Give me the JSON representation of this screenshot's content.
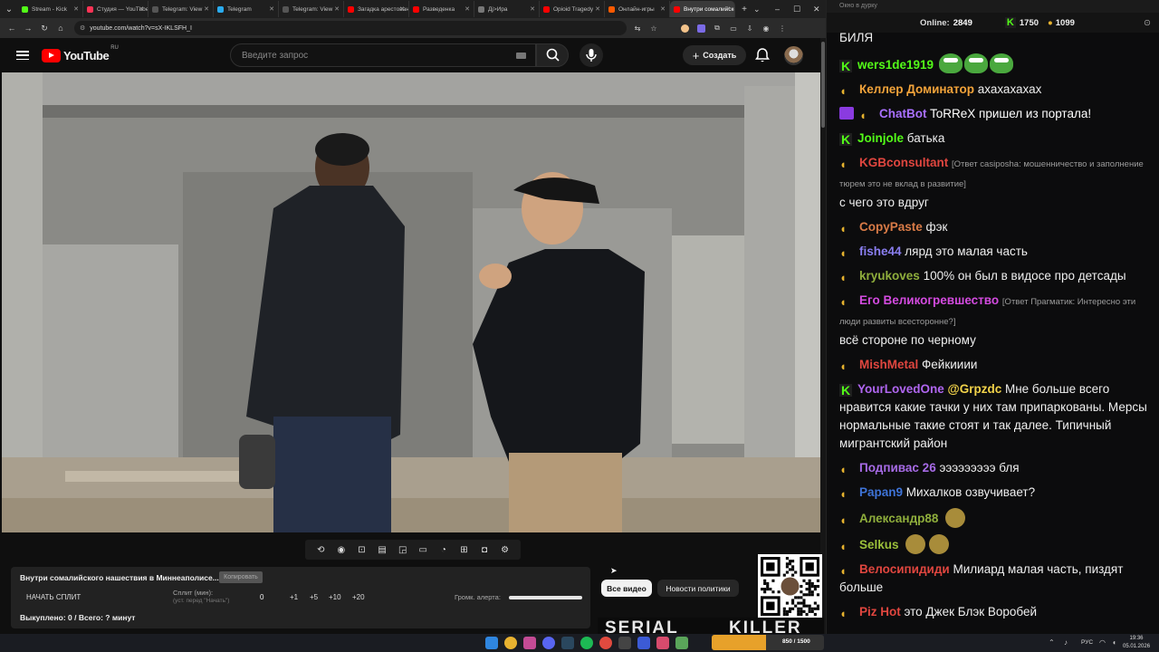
{
  "browser": {
    "tabs": [
      {
        "label": "Stream - Kick",
        "color": "#53fc18"
      },
      {
        "label": "Студия — YouTube",
        "color": "#ff3355"
      },
      {
        "label": "Telegram: View",
        "color": "#555555"
      },
      {
        "label": "Telegram",
        "color": "#2aabee"
      },
      {
        "label": "Telegram: View",
        "color": "#555555"
      },
      {
        "label": "Загадка арестованного",
        "color": "#ff0000"
      },
      {
        "label": "Разведенка",
        "color": "#ff0000"
      },
      {
        "label": "Дj>Ира",
        "color": "#777777"
      },
      {
        "label": "Opioid Tragedy",
        "color": "#ff0000"
      },
      {
        "label": "Онлайн-игры",
        "color": "#ff5a00"
      },
      {
        "label": "Внутри сомалийского",
        "color": "#ff0000",
        "active": true
      }
    ],
    "url": "youtube.com/watch?v=sX-IKLSFH_I"
  },
  "youtube": {
    "logo_text": "YouTube",
    "region": "RU",
    "search_placeholder": "Введите запрос",
    "create_label": "Создать"
  },
  "panel": {
    "video_title": "Внутри сомалийского нашествия в Миннеаполисе...",
    "copy_label": "Копировать",
    "start_split": "НАЧАТЬ СПЛИТ",
    "split_label": "Сплит (мин):",
    "split_hint": "(уст. перед \"Начать\")",
    "split_value": "0",
    "increments": [
      "+1",
      "+5",
      "+10",
      "+20"
    ],
    "alert_volume_label": "Громк. алерта:",
    "alert_volume_level": 1.0,
    "bought": "Выкуплено: 0 / Всего: ? минут"
  },
  "chips": {
    "all_videos": "Все видео",
    "politics_news": "Новости политики"
  },
  "thumbnail_text": {
    "left": "SERIAL",
    "right": "KILLER"
  },
  "chat": {
    "window_title": "Окно в дурку",
    "online_label": "Online:",
    "online_count": "2849",
    "kick_count": "1750",
    "coins_count": "1099",
    "messages": [
      {
        "badge": "",
        "name": "",
        "name_color": "#efefef",
        "reply": "",
        "text": "БИЛЯ"
      },
      {
        "badge": "kick",
        "name": "wers1de1919",
        "name_color": "#53fc18",
        "reply": "",
        "text": "",
        "emotes": 3
      },
      {
        "badge": "coin",
        "name": "Келлер Доминатор",
        "name_color": "#f2a33a",
        "reply": "",
        "text": "ахахахахах"
      },
      {
        "badge": "invader",
        "name": "ChatBot",
        "name_color": "#a970ff",
        "reply": "",
        "text": "ToRReX пришел из портала!",
        "accent_first": true
      },
      {
        "badge": "kick",
        "name": "Joinjole",
        "name_color": "#53fc18",
        "reply": "",
        "text": "батька"
      },
      {
        "badge": "coin",
        "name": "KGBconsultant",
        "name_color": "#e0463f",
        "reply": "[Ответ casiposha: мошенничество и заполнение тюрем это не вклад в развитие]",
        "text": "с чего это вдруг"
      },
      {
        "badge": "coin",
        "name": "CopyPaste",
        "name_color": "#d97b47",
        "reply": "",
        "text": "фэк"
      },
      {
        "badge": "coin",
        "name": "fishe44",
        "name_color": "#8a7ef0",
        "reply": "",
        "text": "лярд это малая часть"
      },
      {
        "badge": "coin",
        "name": "kryukoves",
        "name_color": "#8fae3c",
        "reply": "",
        "text": "100% он был в видосе про детсады"
      },
      {
        "badge": "coin",
        "name": "Его Великогревшество",
        "name_color": "#d44be0",
        "reply": "[Ответ Прагматик: Интересно эти люди развиты всесторонне?]",
        "text": "всё стороне по черному"
      },
      {
        "badge": "coin",
        "name": "MishMetal",
        "name_color": "#e0463f",
        "reply": "",
        "text": "Фейкииии"
      },
      {
        "badge": "kick",
        "name": "YourLovedOne",
        "name_color": "#b066f0",
        "reply": "",
        "mention": "@Grpzdc",
        "text": "Мне больше всего нравится какие тачки у них там припаркованы. Мерсы нормальные такие стоят и так далее. Типичный мигрантский район"
      },
      {
        "badge": "coin",
        "name": "Подпивас 26",
        "name_color": "#a76be6",
        "reply": "",
        "text": "эээээээээ бля"
      },
      {
        "badge": "coin",
        "name": "Papan9",
        "name_color": "#3e73d6",
        "reply": "",
        "text": "Михалков озвучивает?"
      },
      {
        "badge": "coin",
        "name": "Александр88",
        "name_color": "#8fae3c",
        "reply": "",
        "text": "",
        "emotes": 1
      },
      {
        "badge": "coin",
        "name": "Selkus",
        "name_color": "#9abf3a",
        "reply": "",
        "text": "",
        "emotes": 2
      },
      {
        "badge": "coin",
        "name": "Велосипидиди",
        "name_color": "#e0463f",
        "reply": "",
        "text": "Милиард малая часть, пиздят больше"
      },
      {
        "badge": "coin",
        "name": "Piz Hot",
        "name_color": "#e0463f",
        "reply": "",
        "text": "это Джек Блэк Воробей"
      }
    ]
  },
  "taskbar": {
    "overlay_text": "850 / 1500",
    "lang": "РУС",
    "time": "19:36",
    "date": "05.01.2026"
  }
}
